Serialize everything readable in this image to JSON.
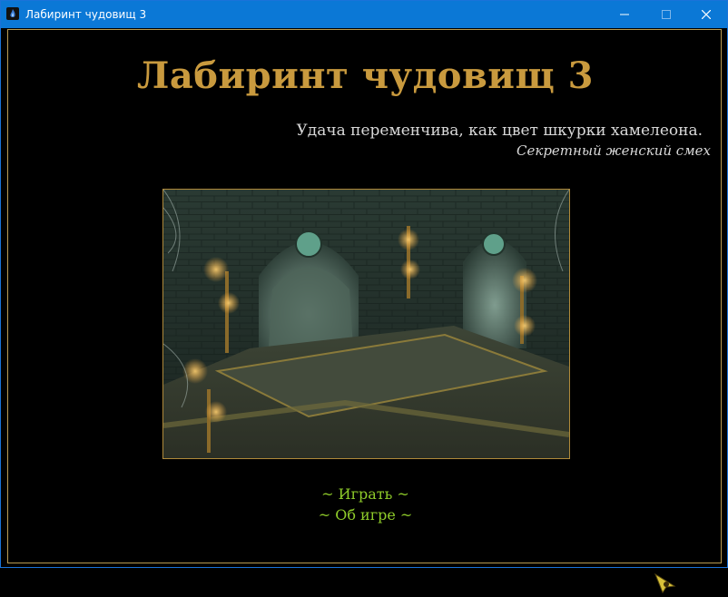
{
  "window": {
    "title": "Лабиринт чудовищ 3",
    "icon": "app-flame-icon",
    "controls": [
      "minimize-icon",
      "maximize-icon",
      "close-icon"
    ]
  },
  "game": {
    "title": "Лабиринт чудовищ 3",
    "quote": "Удача переменчива, как цвет шкурки хамелеона.",
    "quote_author": "Секретный женский смех"
  },
  "menu": {
    "play_label": "~  Играть  ~",
    "about_label": "~  Об игре  ~"
  },
  "colors": {
    "titlebar": "#0b78d6",
    "title_gold": "#c99a3e",
    "menu_green": "#8fcc2a",
    "frame_border": "#b89a52"
  }
}
